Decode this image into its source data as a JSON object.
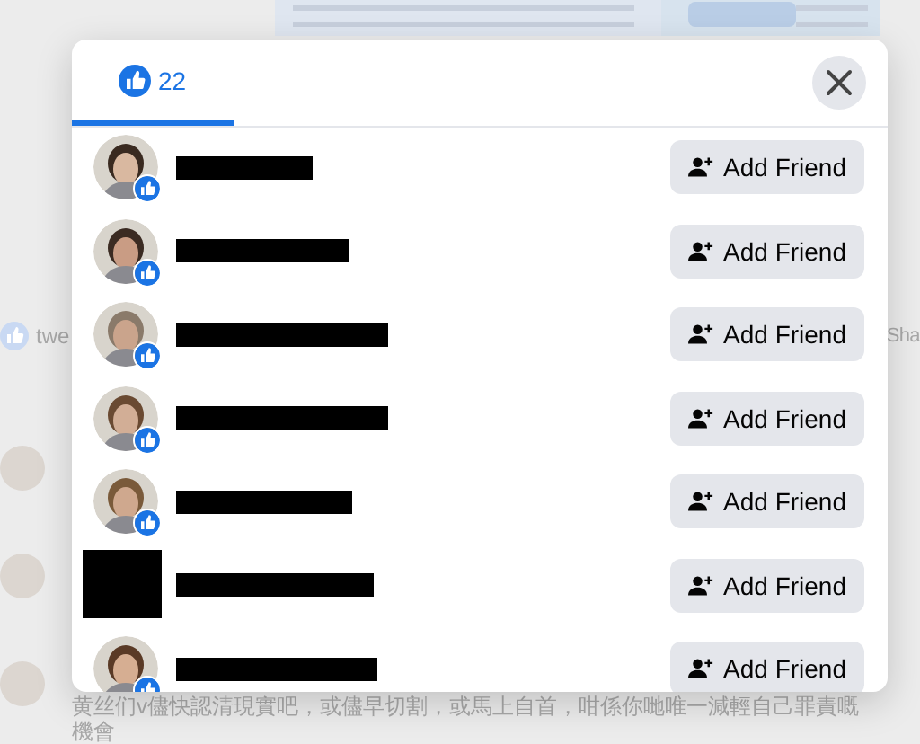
{
  "background": {
    "share_row": {
      "left_label": "twe",
      "right_label": "Sha"
    },
    "comment": {
      "text": "黄丝们v儘快認清現實吧，或儘早切割，或馬上自首，咁係你哋唯一減輕自己罪責嘅機會"
    }
  },
  "dialog": {
    "tabs": [
      {
        "label": "22",
        "selected": true
      }
    ],
    "people": [
      {
        "name_redacted": true,
        "button": "Add Friend"
      },
      {
        "name_redacted": true,
        "button": "Add Friend"
      },
      {
        "name_redacted": true,
        "button": "Add Friend"
      },
      {
        "name_redacted": true,
        "button": "Add Friend"
      },
      {
        "name_redacted": true,
        "button": "Add Friend"
      },
      {
        "kind": "redacted",
        "name_redacted": true,
        "button": "Add Friend"
      },
      {
        "name_redacted": true,
        "button": "Add Friend"
      }
    ]
  }
}
